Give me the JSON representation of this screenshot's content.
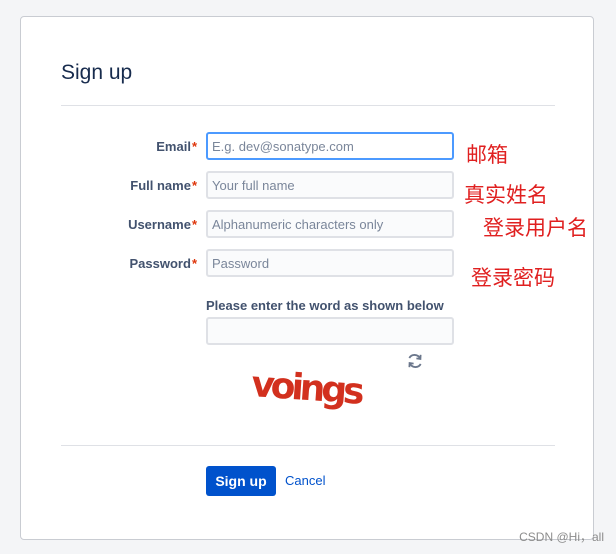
{
  "form": {
    "title": "Sign up",
    "required_marker": "*",
    "fields": [
      {
        "label": "Email",
        "placeholder": "E.g. dev@sonatype.com",
        "value": "",
        "annotation": "邮箱"
      },
      {
        "label": "Full name",
        "placeholder": "Your full name",
        "value": "",
        "annotation": "真实姓名"
      },
      {
        "label": "Username",
        "placeholder": "Alphanumeric characters only",
        "value": "",
        "annotation": "登录用户名"
      },
      {
        "label": "Password",
        "placeholder": "Password",
        "value": "",
        "annotation": "登录密码"
      }
    ],
    "captcha": {
      "prompt": "Please enter the word as shown below",
      "value": "",
      "word": "voings",
      "color": "#d2301e",
      "refresh_icon": "refresh-icon"
    },
    "buttons": {
      "submit": "Sign up",
      "cancel": "Cancel"
    }
  },
  "colors": {
    "primary": "#0052cc",
    "required": "#de350b",
    "annotation": "#e02020",
    "focus_border": "#4c9aff"
  },
  "watermark": "CSDN @Hi，all"
}
